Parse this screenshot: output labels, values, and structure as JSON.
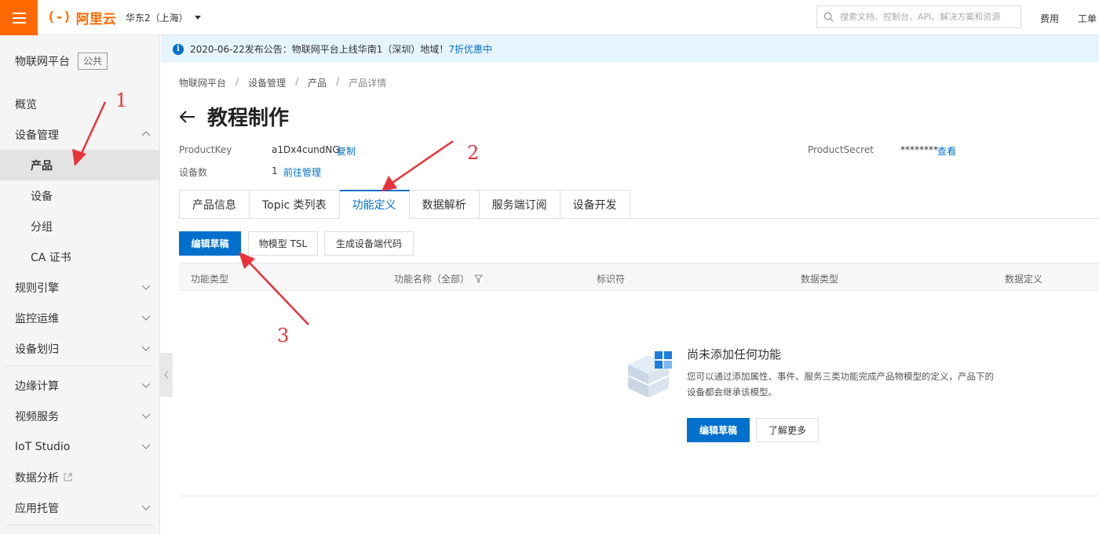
{
  "topbar": {
    "logo_mark": "(-)",
    "logo_text": "阿里云",
    "region": "华东2（上海）",
    "search_placeholder": "搜索文档、控制台、API、解决方案和资源",
    "links": [
      "费用",
      "工单"
    ]
  },
  "sidebar": {
    "title": "物联网平台",
    "badge": "公共",
    "items": [
      {
        "label": "概览"
      },
      {
        "label": "设备管理"
      },
      {
        "label": "产品"
      },
      {
        "label": "设备"
      },
      {
        "label": "分组"
      },
      {
        "label": "CA 证书"
      },
      {
        "label": "规则引擎"
      },
      {
        "label": "监控运维"
      },
      {
        "label": "设备划归"
      },
      {
        "label": "边缘计算"
      },
      {
        "label": "视频服务"
      },
      {
        "label": "IoT Studio"
      },
      {
        "label": "数据分析"
      },
      {
        "label": "应用托管"
      }
    ]
  },
  "notice": {
    "text": "2020-06-22发布公告：物联网平台上线华南1（深圳）地域！",
    "link": "7折优惠中"
  },
  "breadcrumb": [
    "物联网平台",
    "设备管理",
    "产品",
    "产品详情"
  ],
  "breadcrumb_sep": "/",
  "page": {
    "title": "教程制作",
    "product_key_label": "ProductKey",
    "product_key_value": "a1Dx4cundNG",
    "copy_link": "复制",
    "device_count_label": "设备数",
    "device_count_value": "1",
    "manage_link": "前往管理",
    "product_secret_label": "ProductSecret",
    "product_secret_value": "********",
    "view_link": "查看"
  },
  "tabs": [
    "产品信息",
    "Topic 类列表",
    "功能定义",
    "数据解析",
    "服务端订阅",
    "设备开发"
  ],
  "actions": {
    "edit_draft": "编辑草稿",
    "tsl": "物模型 TSL",
    "gen_code": "生成设备端代码"
  },
  "table": {
    "headers": [
      "功能类型",
      "功能名称（全部）",
      "标识符",
      "数据类型",
      "数据定义"
    ]
  },
  "empty": {
    "title": "尚未添加任何功能",
    "desc": "您可以通过添加属性、事件、服务三类功能完成产品物模型的定义，产品下的设备都会继承该模型。",
    "edit_button": "编辑草稿",
    "learn_button": "了解更多"
  },
  "annotations": [
    "1",
    "2",
    "3"
  ],
  "colors": {
    "brand": "#ff6a00",
    "primary": "#0070cc",
    "annotation": "#e8333b"
  }
}
